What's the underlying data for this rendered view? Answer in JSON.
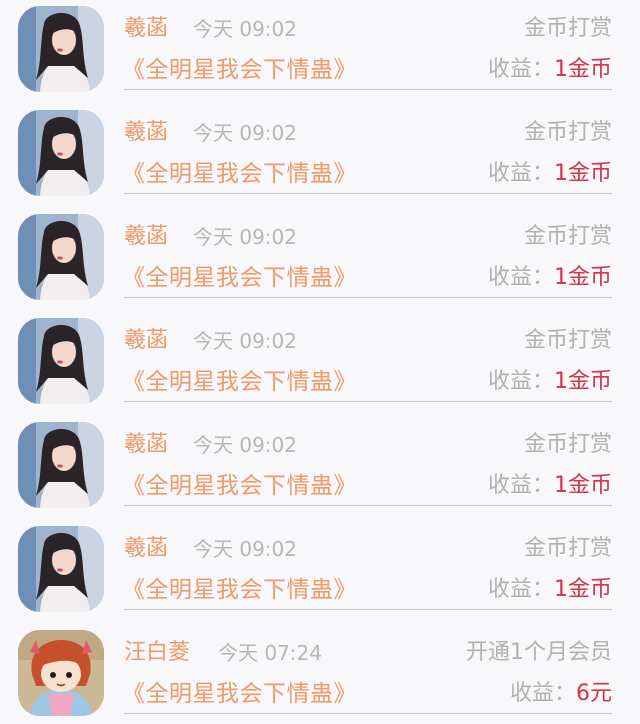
{
  "colors": {
    "background": "#f8f7fa",
    "name": "#ee9a6a",
    "muted": "#b1b1b1",
    "income_value": "#d63447"
  },
  "records": [
    {
      "name": "羲菡",
      "time": "今天 09:02",
      "type": "金币打赏",
      "book": "《全明星我会下情蛊》",
      "income_label": "收益：",
      "income_value": "1金币",
      "avatar": "portrait-avatar"
    },
    {
      "name": "羲菡",
      "time": "今天 09:02",
      "type": "金币打赏",
      "book": "《全明星我会下情蛊》",
      "income_label": "收益：",
      "income_value": "1金币",
      "avatar": "portrait-avatar"
    },
    {
      "name": "羲菡",
      "time": "今天 09:02",
      "type": "金币打赏",
      "book": "《全明星我会下情蛊》",
      "income_label": "收益：",
      "income_value": "1金币",
      "avatar": "portrait-avatar"
    },
    {
      "name": "羲菡",
      "time": "今天 09:02",
      "type": "金币打赏",
      "book": "《全明星我会下情蛊》",
      "income_label": "收益：",
      "income_value": "1金币",
      "avatar": "portrait-avatar"
    },
    {
      "name": "羲菡",
      "time": "今天 09:02",
      "type": "金币打赏",
      "book": "《全明星我会下情蛊》",
      "income_label": "收益：",
      "income_value": "1金币",
      "avatar": "portrait-avatar"
    },
    {
      "name": "羲菡",
      "time": "今天 09:02",
      "type": "金币打赏",
      "book": "《全明星我会下情蛊》",
      "income_label": "收益：",
      "income_value": "1金币",
      "avatar": "portrait-avatar"
    },
    {
      "name": "汪白菱",
      "time": "今天 07:24",
      "type": "开通1个月会员",
      "book": "《全明星我会下情蛊》",
      "income_label": "收益：",
      "income_value": "6元",
      "avatar": "anime-girl-avatar"
    }
  ]
}
